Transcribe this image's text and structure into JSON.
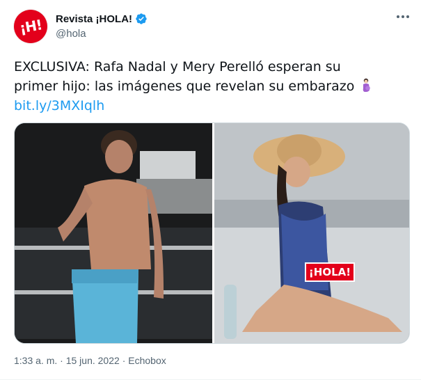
{
  "tweet": {
    "display_name": "Revista ¡HOLA!",
    "handle": "@hola",
    "avatar_text": "¡H!",
    "text_line1": "EXCLUSIVA: Rafa Nadal y Mery Perelló esperan su",
    "text_line2": "primer hijo: las imágenes que revelan su embarazo",
    "emoji_icon": "pregnant-woman-emoji-icon",
    "link": "bit.ly/3MXIqlh",
    "media_badge": "¡HOLA!",
    "time": "1:33 a. m.",
    "separator": "·",
    "date": "15 jun. 2022",
    "source": "Echobox"
  },
  "colors": {
    "link": "#1d9bf0",
    "verified": "#1d9bf0",
    "brand_red": "#e3001b",
    "muted": "#536471"
  }
}
